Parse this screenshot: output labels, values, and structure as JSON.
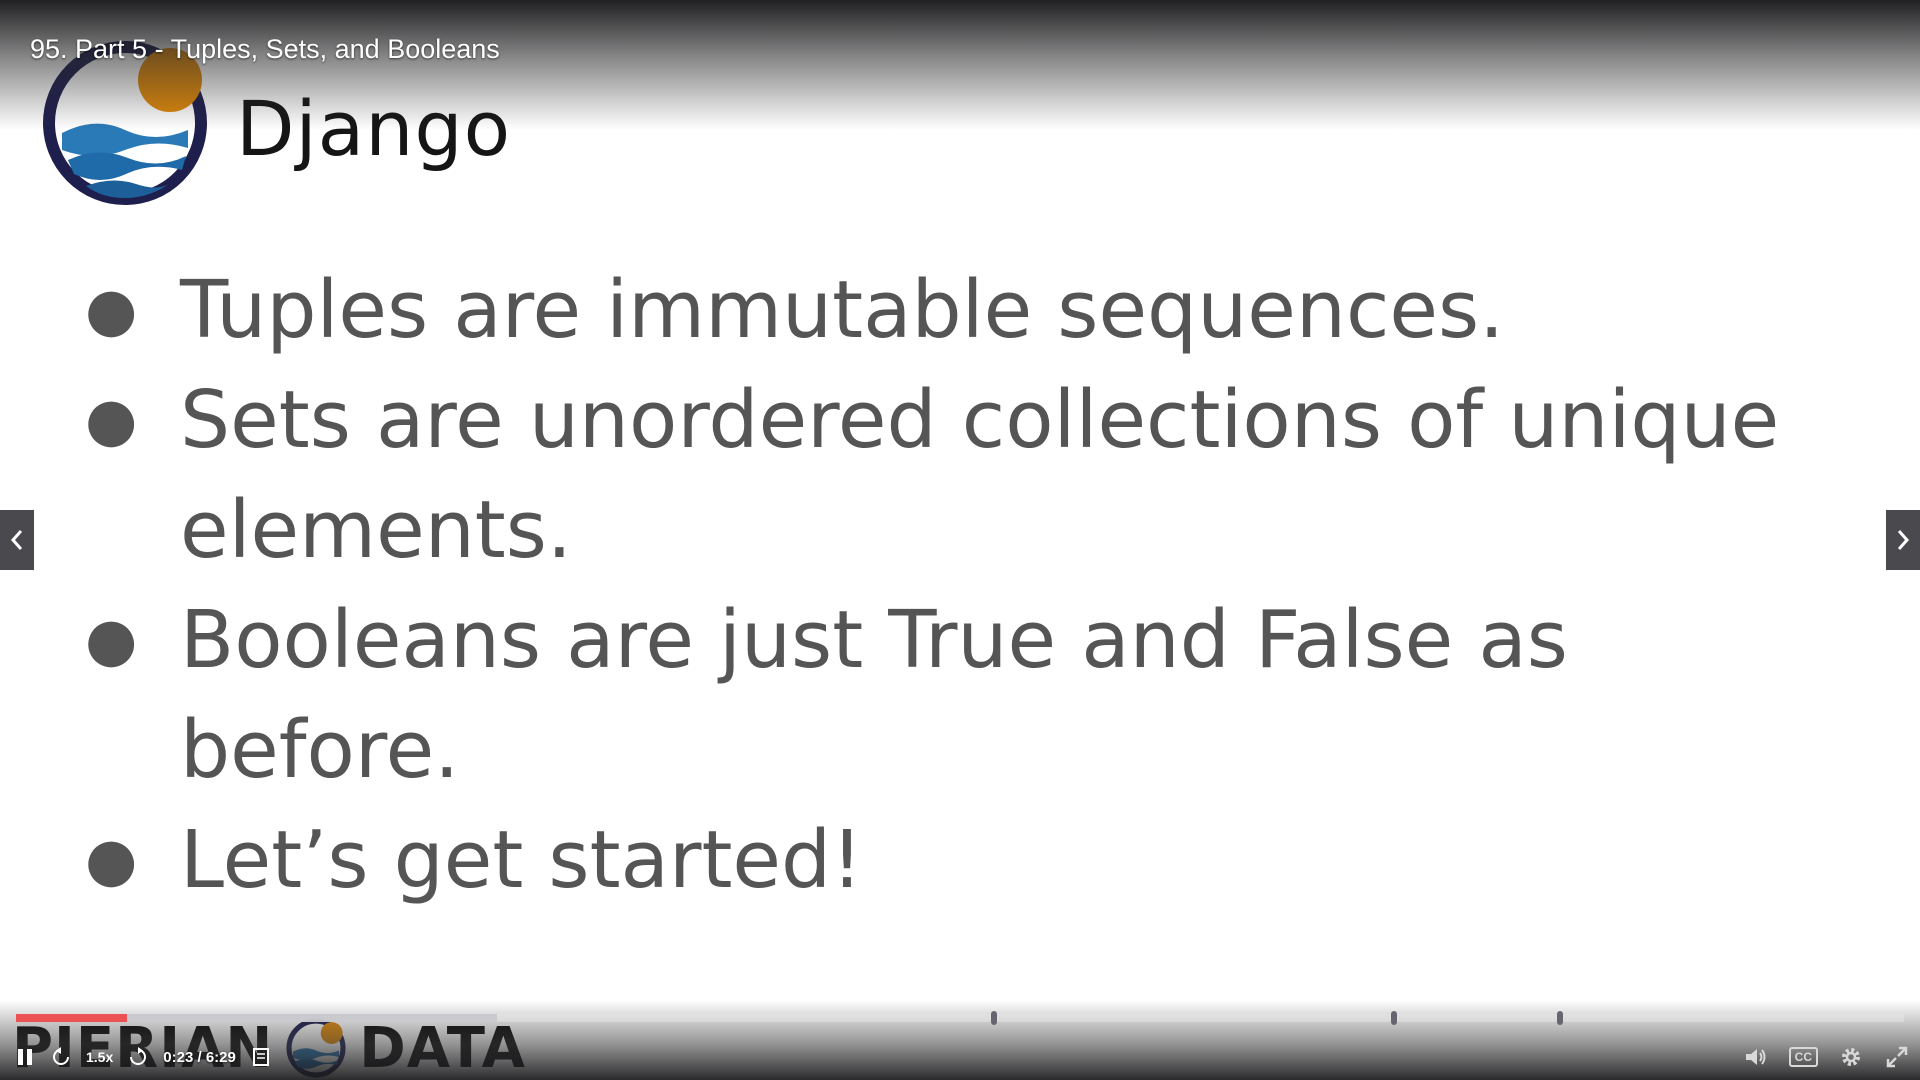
{
  "player": {
    "lecture_title": "95. Part 5 - Tuples, Sets, and Booleans",
    "current_time": "0:23",
    "duration": "6:29",
    "time_separator": "/",
    "speed": "1.5",
    "speed_suffix": "x",
    "progress_fraction": 0.059,
    "buffered_fraction": 0.255,
    "chapter_marker_fractions": [
      0.518,
      0.73,
      0.818
    ],
    "accent_color": "#ec5252"
  },
  "slide": {
    "brand_name": "Django",
    "bullets": [
      "Tuples are immutable sequences.",
      "Sets are unordered collections of unique elements.",
      "Booleans are just True and False as before.",
      "Let’s get started!"
    ],
    "bullet_symbol": "●",
    "text_color": "#555555",
    "footer": {
      "left_word": "PIERIAN",
      "right_word": "DATA"
    }
  },
  "icons": {
    "prev": "chevron-left-icon",
    "next": "chevron-right-icon",
    "play_pause": "pause-icon",
    "rewind": "rewind-icon",
    "forward": "forward-icon",
    "transcript": "transcript-icon",
    "volume": "volume-icon",
    "captions": "closed-captions-icon",
    "settings": "gear-icon",
    "fullscreen": "expand-icon"
  },
  "captions_label": "CC"
}
